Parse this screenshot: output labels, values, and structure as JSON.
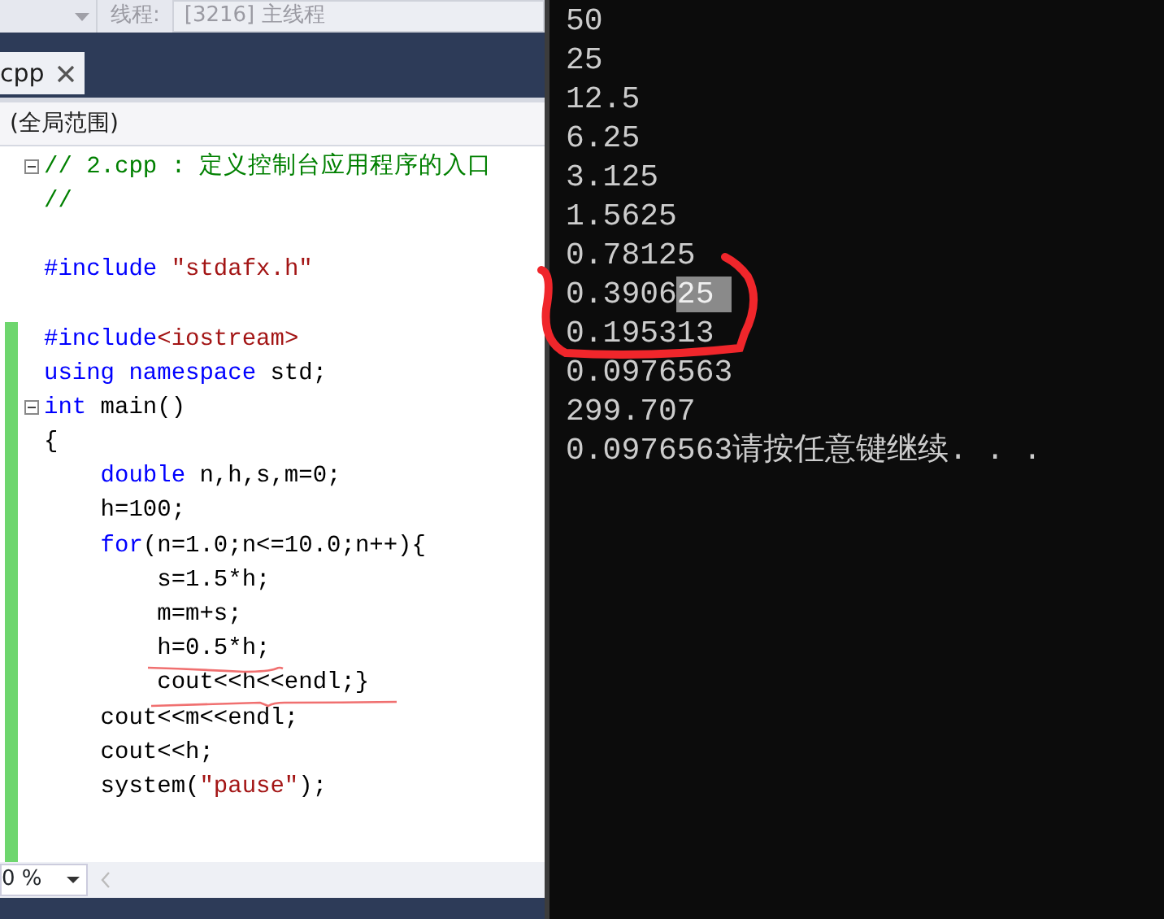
{
  "toolbar": {
    "thread_label": "线程:",
    "thread_value": "[3216] 主线程"
  },
  "tabs": [
    {
      "label": "cpp",
      "selected": true
    }
  ],
  "scope": "(全局范围)",
  "code_lines": [
    {
      "fold": true,
      "changed": false,
      "tokens": [
        {
          "kind": "comment",
          "text": "// 2.cpp : 定义控制台应用程序的入口"
        }
      ]
    },
    {
      "fold": false,
      "changed": false,
      "tokens": [
        {
          "kind": "comment",
          "text": "//"
        }
      ]
    },
    {
      "fold": false,
      "changed": false
    },
    {
      "fold": false,
      "changed": false,
      "tokens": [
        {
          "kind": "keyword",
          "text": "#include "
        },
        {
          "kind": "string",
          "text": "\"stdafx.h\""
        }
      ]
    },
    {
      "fold": false,
      "changed": false
    },
    {
      "fold": false,
      "changed": true,
      "tokens": [
        {
          "kind": "keyword",
          "text": "#include"
        },
        {
          "kind": "string",
          "text": "<iostream>"
        }
      ]
    },
    {
      "fold": false,
      "changed": true,
      "tokens": [
        {
          "kind": "keyword",
          "text": "using namespace"
        },
        {
          "kind": "plain",
          "text": " std;"
        }
      ]
    },
    {
      "fold": true,
      "changed": true,
      "tokens": [
        {
          "kind": "keyword",
          "text": "int"
        },
        {
          "kind": "plain",
          "text": " main()"
        }
      ]
    },
    {
      "fold": false,
      "changed": true,
      "tokens": [
        {
          "kind": "plain",
          "text": "{"
        }
      ]
    },
    {
      "fold": false,
      "changed": true,
      "tokens": [
        {
          "kind": "keyword",
          "text": "    double"
        },
        {
          "kind": "plain",
          "text": " n,h,s,m=0;"
        }
      ]
    },
    {
      "fold": false,
      "changed": true,
      "tokens": [
        {
          "kind": "plain",
          "text": "    h=100;"
        }
      ]
    },
    {
      "fold": false,
      "changed": true,
      "tokens": [
        {
          "kind": "keyword",
          "text": "    for"
        },
        {
          "kind": "plain",
          "text": "(n=1.0;n<=10.0;n++){"
        }
      ]
    },
    {
      "fold": false,
      "changed": true,
      "tokens": [
        {
          "kind": "plain",
          "text": "        s=1.5*h;"
        }
      ]
    },
    {
      "fold": false,
      "changed": true,
      "tokens": [
        {
          "kind": "plain",
          "text": "        m=m+s;"
        }
      ]
    },
    {
      "fold": false,
      "changed": true,
      "tokens": [
        {
          "kind": "plain",
          "text": "        h=0.5*h;"
        }
      ]
    },
    {
      "fold": false,
      "changed": true,
      "tokens": [
        {
          "kind": "plain",
          "text": "        cout<<h<<endl;}"
        }
      ]
    },
    {
      "fold": false,
      "changed": true,
      "tokens": [
        {
          "kind": "plain",
          "text": "    cout<<m<<endl;"
        }
      ]
    },
    {
      "fold": false,
      "changed": true,
      "tokens": [
        {
          "kind": "plain",
          "text": "    cout<<h;"
        }
      ]
    },
    {
      "fold": false,
      "changed": true,
      "tokens": [
        {
          "kind": "plain",
          "text": "    system("
        },
        {
          "kind": "string",
          "text": "\"pause\""
        },
        {
          "kind": "plain",
          "text": ");"
        }
      ]
    },
    {
      "fold": false,
      "changed": true
    },
    {
      "fold": false,
      "changed": true
    }
  ],
  "zoom": "0 %",
  "console": {
    "lines": [
      {
        "parts": [
          {
            "text": "50",
            "selected": false
          }
        ]
      },
      {
        "parts": [
          {
            "text": "25",
            "selected": false
          }
        ]
      },
      {
        "parts": [
          {
            "text": "12.5",
            "selected": false
          }
        ]
      },
      {
        "parts": [
          {
            "text": "6.25",
            "selected": false
          }
        ]
      },
      {
        "parts": [
          {
            "text": "3.125",
            "selected": false
          }
        ]
      },
      {
        "parts": [
          {
            "text": "1.5625",
            "selected": false
          }
        ]
      },
      {
        "parts": [
          {
            "text": "0.78125",
            "selected": false
          }
        ]
      },
      {
        "parts": [
          {
            "text": "0.3906",
            "selected": false
          },
          {
            "text": "25",
            "selected": true
          }
        ]
      },
      {
        "parts": [
          {
            "text": "0.195313",
            "selected": false
          }
        ]
      },
      {
        "parts": [
          {
            "text": "0.0976563",
            "selected": false
          }
        ]
      },
      {
        "parts": [
          {
            "text": "299.707",
            "selected": false
          }
        ]
      },
      {
        "parts": [
          {
            "text": "0.0976563请按任意键继续. . .",
            "selected": false
          }
        ]
      }
    ]
  }
}
